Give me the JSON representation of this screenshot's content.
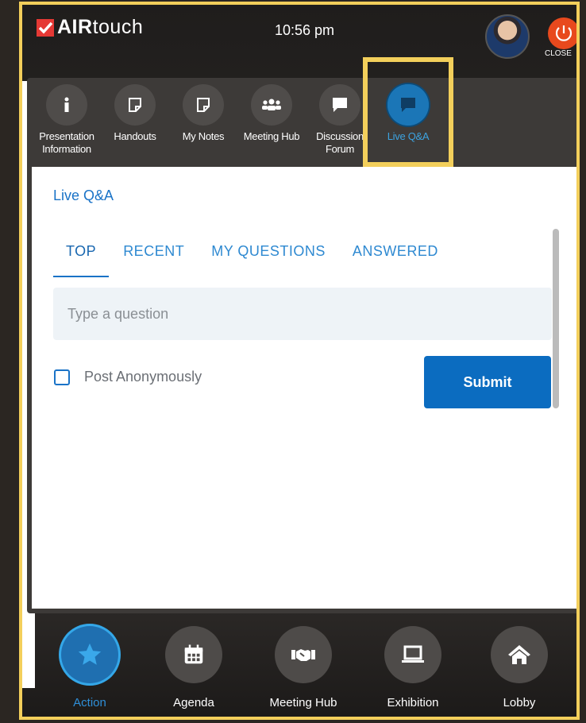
{
  "header": {
    "brand_bold": "AIR",
    "brand_rest": "touch",
    "time": "10:56 pm",
    "close_label": "CLOSE"
  },
  "apps": [
    {
      "label": "Presentation Information",
      "icon": "info-icon"
    },
    {
      "label": "Handouts",
      "icon": "note-icon"
    },
    {
      "label": "My Notes",
      "icon": "note-icon"
    },
    {
      "label": "Meeting Hub",
      "icon": "people-icon"
    },
    {
      "label": "Discussion Forum",
      "icon": "chat-bubble-icon"
    },
    {
      "label": "Live Q&A",
      "icon": "chat-bubble-icon",
      "active": true
    }
  ],
  "qa": {
    "title": "Live Q&A",
    "tabs": [
      "TOP",
      "RECENT",
      "MY QUESTIONS",
      "ANSWERED"
    ],
    "active_tab": "TOP",
    "question_placeholder": "Type a question",
    "anonymous_label": "Post Anonymously",
    "anonymous_checked": false,
    "submit_label": "Submit"
  },
  "nav": [
    {
      "label": "Action",
      "icon": "star-icon",
      "active": true
    },
    {
      "label": "Agenda",
      "icon": "calendar-icon"
    },
    {
      "label": "Meeting Hub",
      "icon": "handshake-icon"
    },
    {
      "label": "Exhibition",
      "icon": "laptop-icon"
    },
    {
      "label": "Lobby",
      "icon": "home-icon"
    }
  ],
  "colors": {
    "highlight": "#f3cf5b",
    "accent": "#1a73c7",
    "close": "#e8491d"
  }
}
